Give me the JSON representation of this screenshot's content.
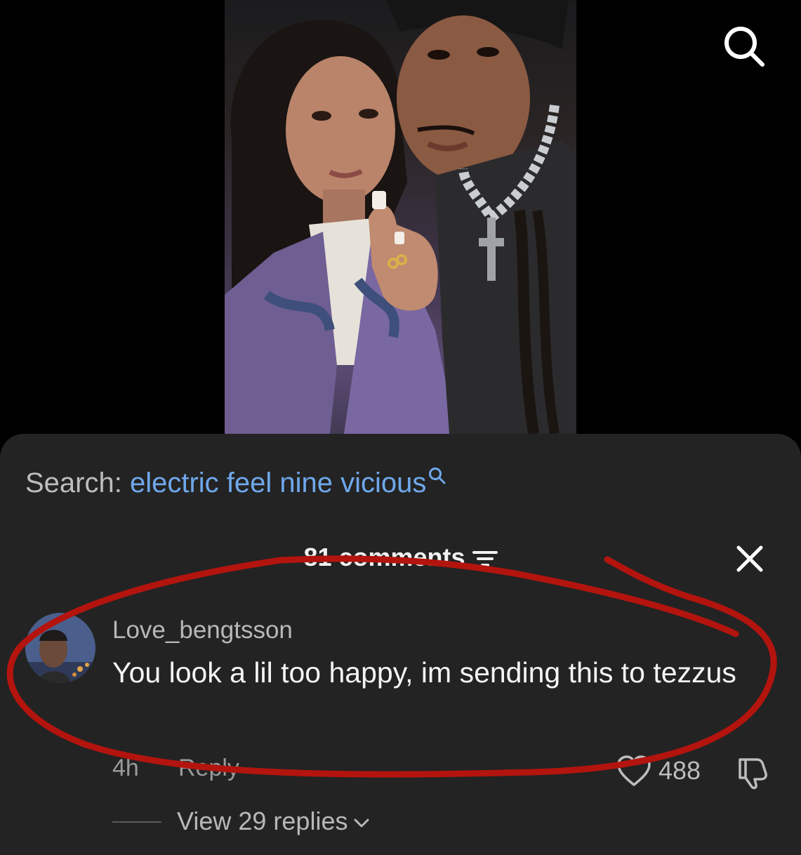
{
  "search": {
    "label": "Search:",
    "query": "electric feel nine vicious"
  },
  "comments_panel": {
    "count_label": "81 comments"
  },
  "comment": {
    "username": "Love_bengtsson",
    "text": "You look a lil too happy, im sending this to tezzus",
    "time": "4h",
    "reply_label": "Reply",
    "likes": "488",
    "view_replies": "View 29 replies"
  },
  "colors": {
    "sheet_bg": "#232323",
    "link_blue": "#6fa8ec",
    "annotation_red": "#b3140e"
  },
  "icons": [
    "search-icon",
    "filter-icon",
    "close-icon",
    "heart-icon",
    "dislike-icon",
    "chevron-down-icon"
  ]
}
